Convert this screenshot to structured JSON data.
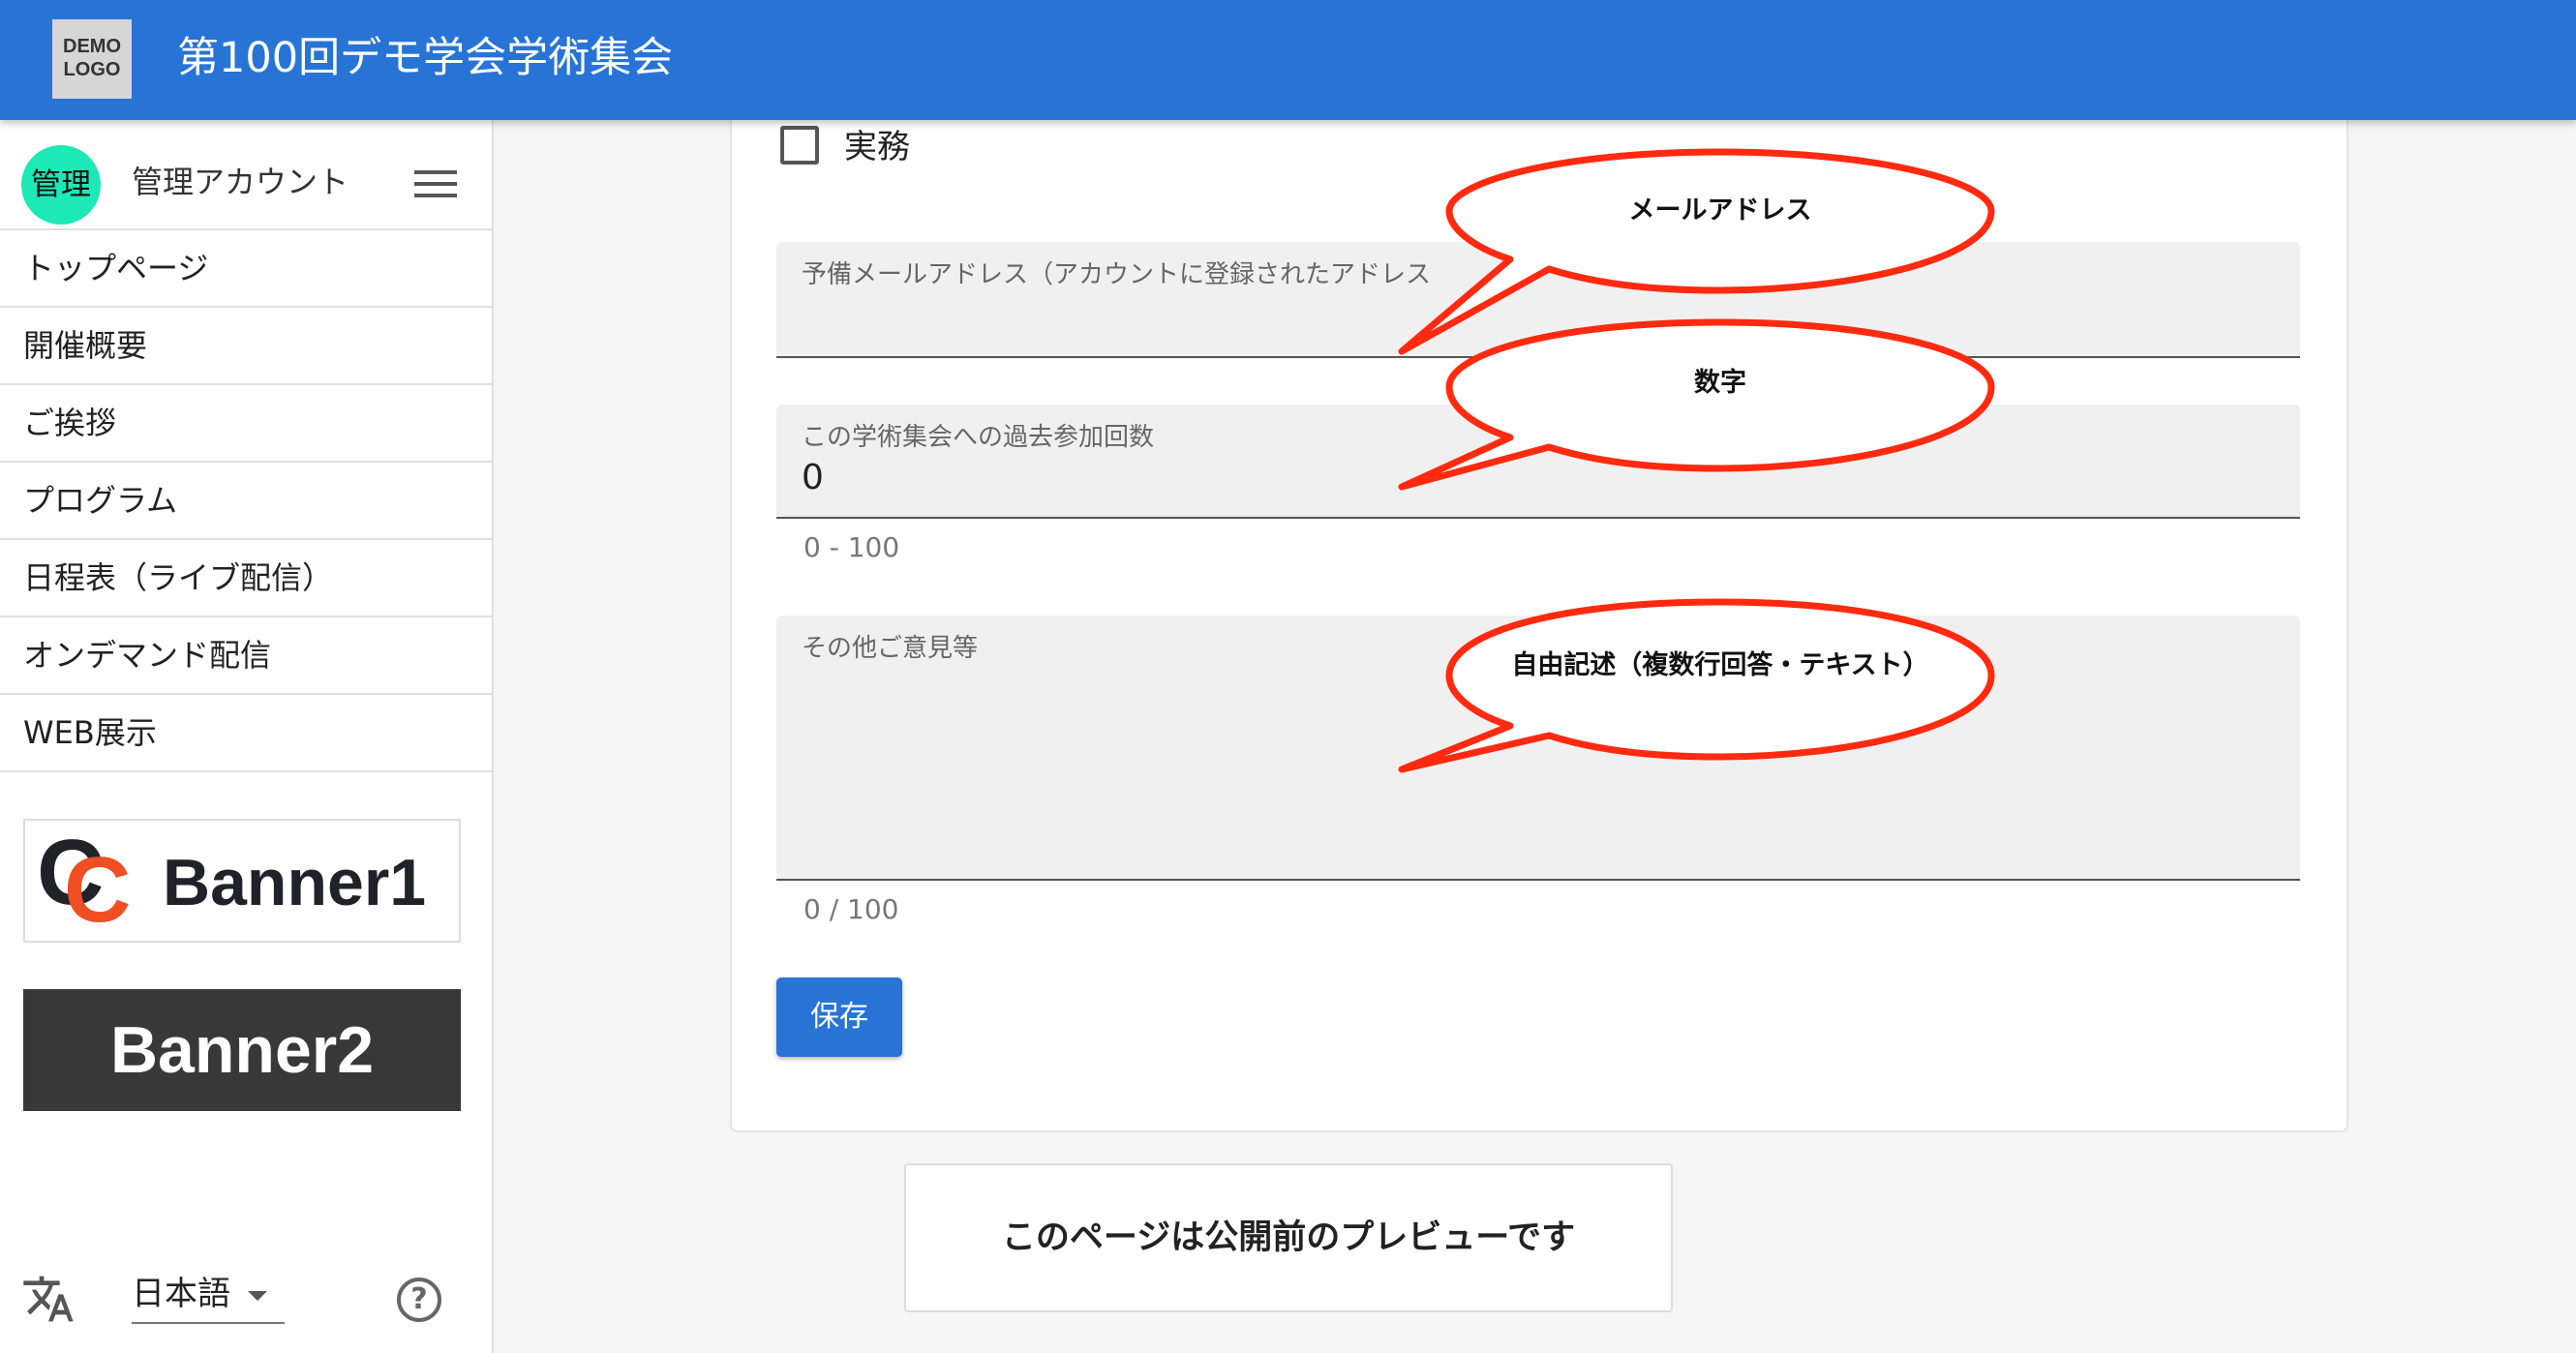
{
  "header": {
    "logo_text": "DEMO LOGO",
    "title": "第100回デモ学会学術集会"
  },
  "sidebar": {
    "avatar": "管理",
    "account_name": "管理アカウント",
    "items": [
      {
        "label": "トップページ"
      },
      {
        "label": "開催概要"
      },
      {
        "label": "ご挨拶"
      },
      {
        "label": "プログラム"
      },
      {
        "label": "日程表（ライブ配信）"
      },
      {
        "label": "オンデマンド配信"
      },
      {
        "label": "WEB展示"
      }
    ],
    "banner1": "Banner1",
    "banner1_logo": "CC",
    "banner2": "Banner2",
    "language": "日本語"
  },
  "form": {
    "checkbox_label": "実務",
    "checkbox_checked": false,
    "email_label": "予備メールアドレス（アカウントに登録されたアドレス",
    "count_label": "この学術集会への過去参加回数",
    "count_value": "0",
    "count_hint": "0 - 100",
    "comment_label": "その他ご意見等",
    "comment_hint": "0 / 100",
    "save_label": "保存"
  },
  "preview_notice": "このページは公開前のプレビューです",
  "callouts": [
    {
      "text": "メールアドレス"
    },
    {
      "text": "数字"
    },
    {
      "text": "自由記述（複数行回答・テキスト）"
    }
  ],
  "colors": {
    "header": "#2774d6",
    "avatar": "#1de9b6",
    "callout_border": "#ff2a10",
    "banner_accent": "#f04e23"
  },
  "icons": {
    "menu": "hamburger-icon",
    "language": "translate-icon",
    "help": "help-circle-icon"
  }
}
